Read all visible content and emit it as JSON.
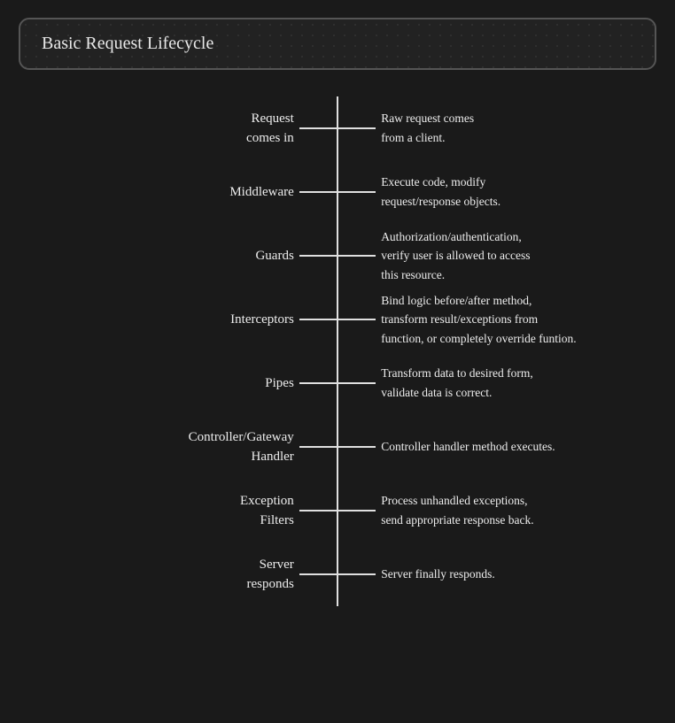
{
  "title": "Basic Request Lifecycle",
  "items": [
    {
      "id": "request-comes-in",
      "label": "Request\ncomes in",
      "description": "Raw request comes\nfrom a client."
    },
    {
      "id": "middleware",
      "label": "Middleware",
      "description": "Execute code, modify\nrequest/response objects."
    },
    {
      "id": "guards",
      "label": "Guards",
      "description": "Authorization/authentication,\nverify user is allowed to access\nthis resource."
    },
    {
      "id": "interceptors",
      "label": "Interceptors",
      "description": "Bind logic before/after method,\ntransform result/exceptions from\nfunction, or completely override funtion."
    },
    {
      "id": "pipes",
      "label": "Pipes",
      "description": "Transform data to desired form,\nvalidate data is correct."
    },
    {
      "id": "controller-gateway-handler",
      "label": "Controller/Gateway\nHandler",
      "description": "Controller handler method executes."
    },
    {
      "id": "exception-filters",
      "label": "Exception\nFilters",
      "description": "Process unhandled exceptions,\nsend appropriate response back."
    },
    {
      "id": "server-responds",
      "label": "Server\nresponds",
      "description": "Server finally responds."
    }
  ]
}
